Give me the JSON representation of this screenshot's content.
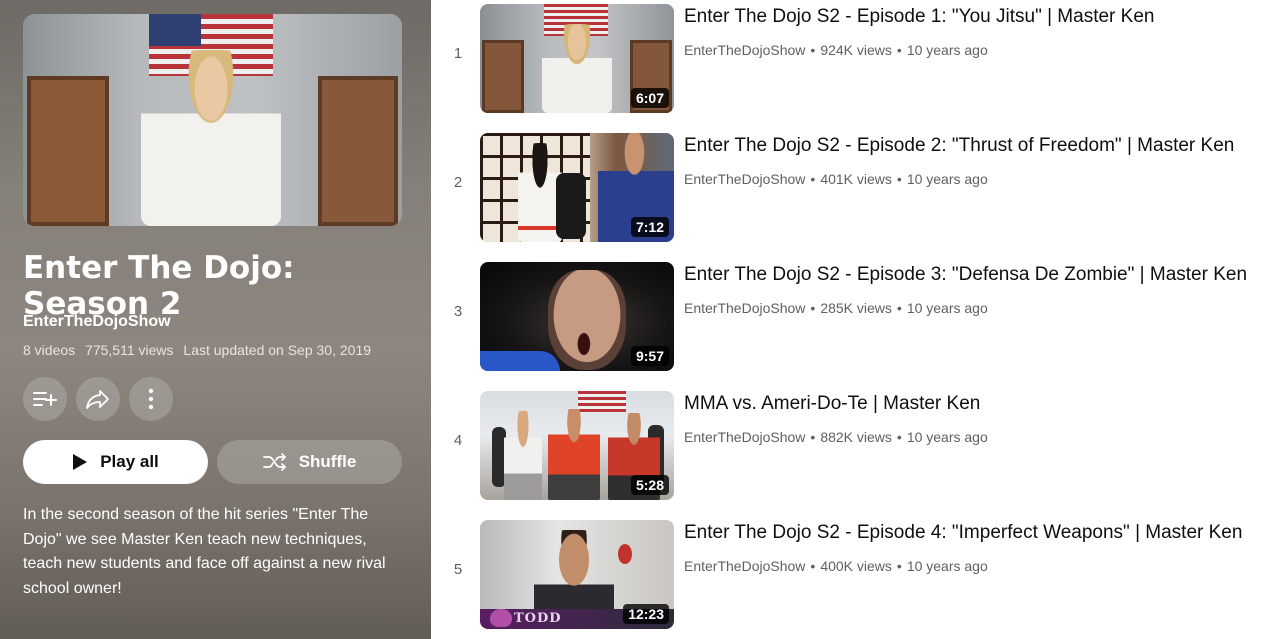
{
  "playlist": {
    "title": "Enter The Dojo: Season 2",
    "channel": "EnterTheDojoShow",
    "video_count": "8 videos",
    "views": "775,511 views",
    "last_updated": "Last updated on Sep 30, 2019",
    "play_all_label": "Play all",
    "shuffle_label": "Shuffle",
    "description": "In the second season of the hit series \"Enter The Dojo\" we see Master Ken teach new techniques, teach new students and face off against a new rival school owner!"
  },
  "icons": {
    "save": "playlist-add-icon",
    "share": "share-icon",
    "more": "more-vert-icon",
    "play": "play-icon",
    "shuffle": "shuffle-icon"
  },
  "videos": [
    {
      "index": "1",
      "title": "Enter The Dojo S2 - Episode 1: \"You Jitsu\" | Master Ken",
      "channel": "EnterTheDojoShow",
      "views": "924K views",
      "age": "10 years ago",
      "duration": "6:07"
    },
    {
      "index": "2",
      "title": "Enter The Dojo S2 - Episode 2: \"Thrust of Freedom\" | Master Ken",
      "channel": "EnterTheDojoShow",
      "views": "401K views",
      "age": "10 years ago",
      "duration": "7:12"
    },
    {
      "index": "3",
      "title": "Enter The Dojo S2 - Episode 3: \"Defensa De Zombie\" | Master Ken",
      "channel": "EnterTheDojoShow",
      "views": "285K views",
      "age": "10 years ago",
      "duration": "9:57"
    },
    {
      "index": "4",
      "title": "MMA vs. Ameri-Do-Te | Master Ken",
      "channel": "EnterTheDojoShow",
      "views": "882K views",
      "age": "10 years ago",
      "duration": "5:28"
    },
    {
      "index": "5",
      "title": "Enter The Dojo S2 - Episode 4: \"Imperfect Weapons\" | Master Ken",
      "channel": "EnterTheDojoShow",
      "views": "400K views",
      "age": "10 years ago",
      "duration": "12:23",
      "thumbnail_caption": "TODD"
    }
  ],
  "separator": "•"
}
